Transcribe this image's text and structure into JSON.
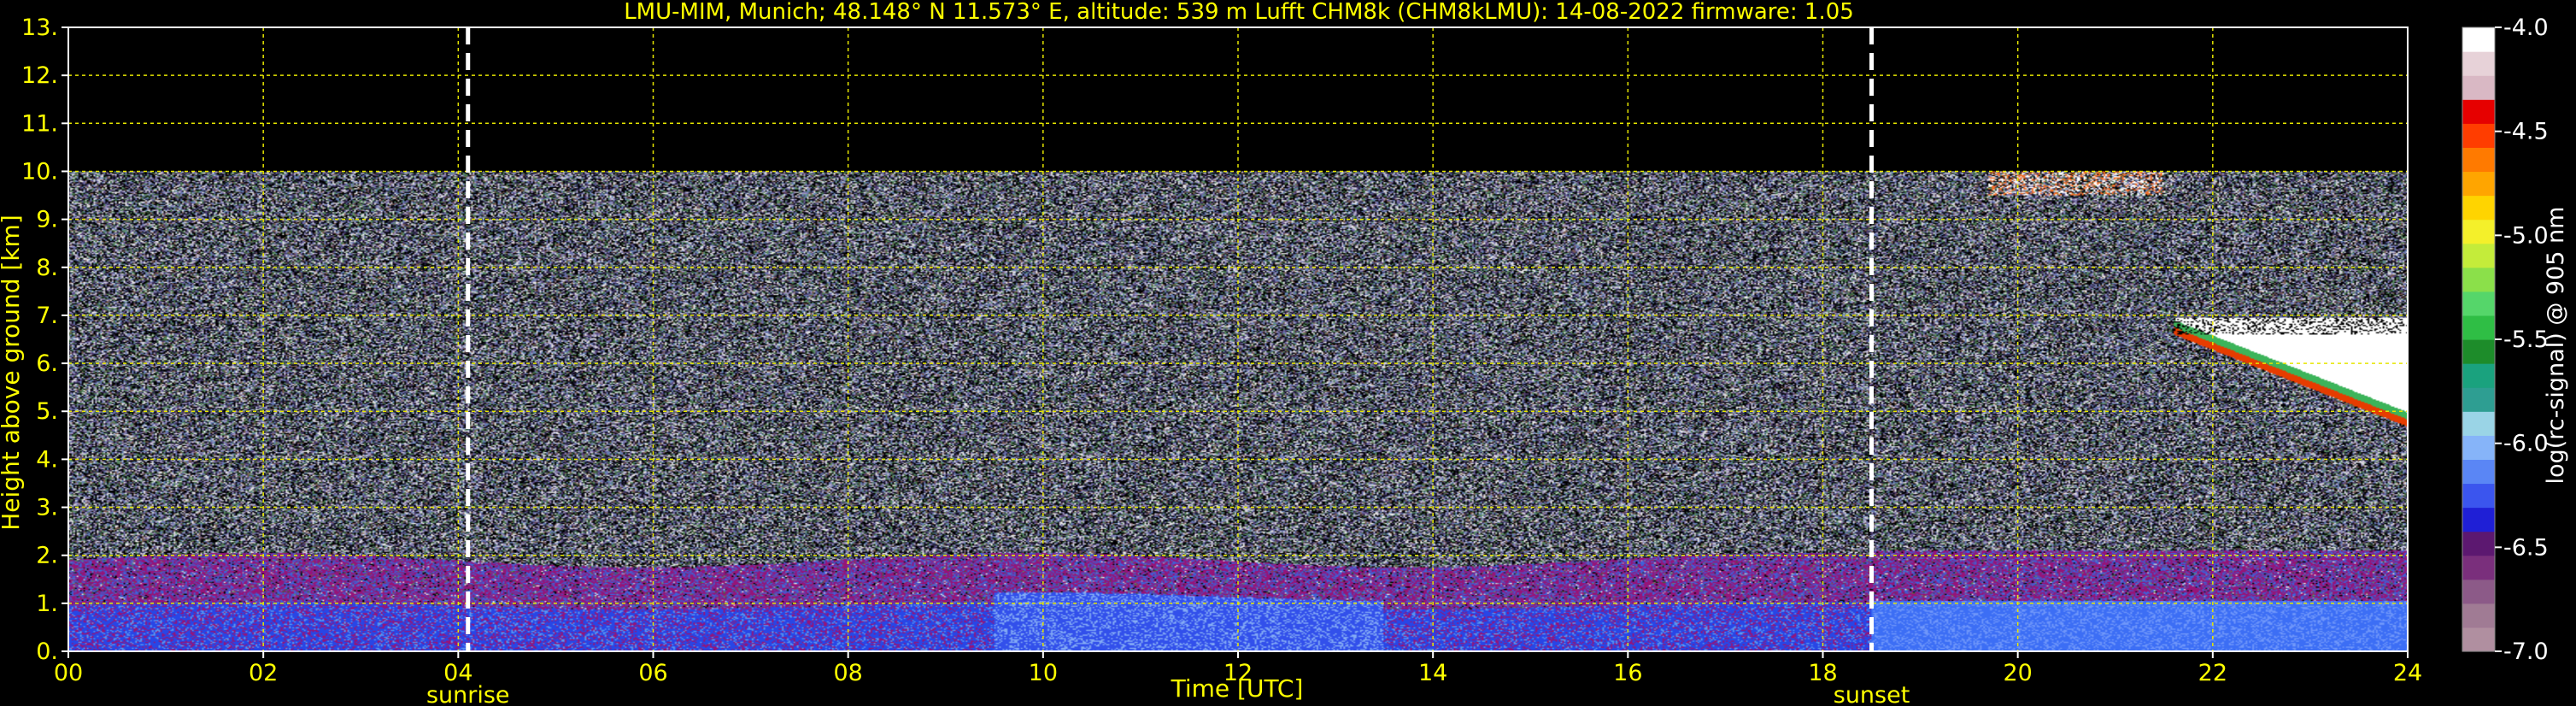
{
  "chart_data": {
    "type": "heatmap",
    "title": "LMU-MIM, Munich; 48.148° N 11.573° E, altitude: 539 m    Lufft CHM8k (CHM8kLMU): 14-08-2022    firmware: 1.05",
    "xlabel": "Time [UTC]",
    "ylabel": "Height above ground [km]",
    "xlim": [
      0,
      24
    ],
    "ylim": [
      0,
      13
    ],
    "x_ticks": [
      "00",
      "02",
      "04",
      "06",
      "08",
      "10",
      "12",
      "14",
      "16",
      "18",
      "20",
      "22",
      "24"
    ],
    "y_ticks": [
      "0.",
      "1.",
      "2.",
      "3.",
      "4.",
      "5.",
      "6.",
      "7.",
      "8.",
      "9.",
      "10.",
      "11.",
      "12.",
      "13."
    ],
    "grid": true,
    "data_top_km": 10,
    "markers": [
      {
        "label": "sunrise",
        "time": 4.1
      },
      {
        "label": "sunset",
        "time": 18.5
      }
    ],
    "colorbar": {
      "label": "log(rc-signal) @ 905 nm",
      "range": [
        -7.0,
        -4.0
      ],
      "ticks": [
        "-4.0",
        "-4.5",
        "-5.0",
        "-5.5",
        "-6.0",
        "-6.5",
        "-7.0"
      ],
      "colors": [
        "#b08fa0",
        "#a07b94",
        "#8c5a88",
        "#7a2f7c",
        "#5c1870",
        "#1f1fd6",
        "#3b55ee",
        "#5a86f5",
        "#86b4f9",
        "#9ad4e6",
        "#2e9e92",
        "#1aa27e",
        "#1d8c2a",
        "#2fbe45",
        "#55d66a",
        "#8be04a",
        "#c4ec3a",
        "#f4f02a",
        "#ffd400",
        "#ffa500",
        "#ff7a00",
        "#ff3d00",
        "#e60000",
        "#d9b8c4",
        "#e7d2d8",
        "#ffffff"
      ]
    },
    "layers": [
      {
        "name": "boundary layer",
        "time_range": [
          0,
          24
        ],
        "height_km": [
          0,
          2.0
        ]
      },
      {
        "name": "cloud",
        "time_range": [
          21.6,
          24
        ],
        "height_km": [
          4.5,
          7.0
        ]
      },
      {
        "name": "high cloud",
        "time_range": [
          19.7,
          21.5
        ],
        "height_km": [
          9.5,
          10.0
        ]
      }
    ]
  }
}
